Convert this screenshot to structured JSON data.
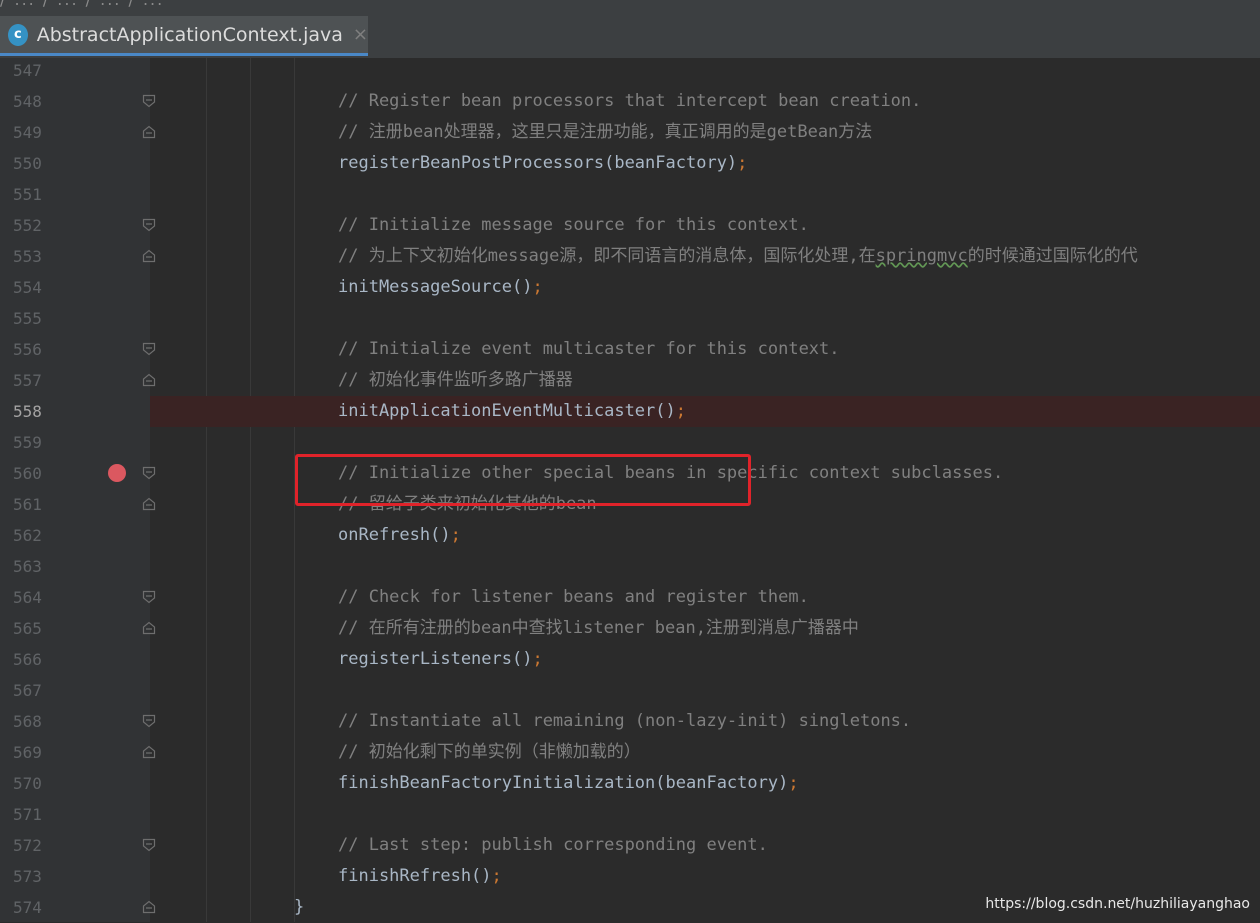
{
  "tab": {
    "icon_letter": "c",
    "file_name": "AbstractApplicationContext.java",
    "close": "×"
  },
  "breadcrumb_faded": "/ ... / ... / ... / ...",
  "current_line": 558,
  "lines": [
    {
      "num": "547",
      "parts": []
    },
    {
      "num": "548",
      "fold": "open",
      "parts": [
        {
          "t": "// Register bean processors that intercept bean creation.",
          "c": "comment"
        }
      ]
    },
    {
      "num": "549",
      "fold": "close",
      "parts": [
        {
          "t": "// 注册bean处理器，这里只是注册功能，真正调用的是getBean方法",
          "c": "comment"
        }
      ]
    },
    {
      "num": "550",
      "parts": [
        {
          "t": "registerBeanPostProcessors(beanFactory)",
          "c": "ident"
        },
        {
          "t": ";",
          "c": "semi"
        }
      ]
    },
    {
      "num": "551",
      "parts": []
    },
    {
      "num": "552",
      "fold": "open",
      "parts": [
        {
          "t": "// Initialize message source for this context.",
          "c": "comment"
        }
      ]
    },
    {
      "num": "553",
      "fold": "close",
      "parts": [
        {
          "t": "// 为上下文初始化message源，即不同语言的消息体，国际化处理,在",
          "c": "comment"
        },
        {
          "t": "springmvc",
          "c": "comment spell"
        },
        {
          "t": "的时候通过国际化的代",
          "c": "comment"
        }
      ]
    },
    {
      "num": "554",
      "parts": [
        {
          "t": "initMessageSource()",
          "c": "ident"
        },
        {
          "t": ";",
          "c": "semi"
        }
      ]
    },
    {
      "num": "555",
      "parts": []
    },
    {
      "num": "556",
      "fold": "open",
      "parts": [
        {
          "t": "// Initialize event multicaster for this context.",
          "c": "comment"
        }
      ]
    },
    {
      "num": "557",
      "fold": "close",
      "parts": [
        {
          "t": "// 初始化事件监听多路广播器",
          "c": "comment"
        }
      ]
    },
    {
      "num": "558",
      "bp": true,
      "parts": [
        {
          "t": "initApplicationEventMulticaster()",
          "c": "ident"
        },
        {
          "t": ";",
          "c": "semi"
        }
      ]
    },
    {
      "num": "559",
      "parts": []
    },
    {
      "num": "560",
      "fold": "open",
      "parts": [
        {
          "t": "// Initialize other special beans in specific context subclasses.",
          "c": "comment"
        }
      ]
    },
    {
      "num": "561",
      "fold": "close",
      "parts": [
        {
          "t": "// 留给子类来初始化其他的bean",
          "c": "comment"
        }
      ]
    },
    {
      "num": "562",
      "parts": [
        {
          "t": "onRefresh()",
          "c": "ident"
        },
        {
          "t": ";",
          "c": "semi"
        }
      ]
    },
    {
      "num": "563",
      "parts": []
    },
    {
      "num": "564",
      "fold": "open",
      "parts": [
        {
          "t": "// Check for listener beans and register them.",
          "c": "comment"
        }
      ]
    },
    {
      "num": "565",
      "fold": "close",
      "parts": [
        {
          "t": "// 在所有注册的bean中查找listener bean,注册到消息广播器中",
          "c": "comment"
        }
      ]
    },
    {
      "num": "566",
      "parts": [
        {
          "t": "registerListeners()",
          "c": "ident"
        },
        {
          "t": ";",
          "c": "semi"
        }
      ]
    },
    {
      "num": "567",
      "parts": []
    },
    {
      "num": "568",
      "fold": "open",
      "parts": [
        {
          "t": "// Instantiate all remaining (non-lazy-init) singletons.",
          "c": "comment"
        }
      ]
    },
    {
      "num": "569",
      "fold": "close",
      "parts": [
        {
          "t": "// 初始化剩下的单实例（非懒加载的）",
          "c": "comment"
        }
      ]
    },
    {
      "num": "570",
      "parts": [
        {
          "t": "finishBeanFactoryInitialization(beanFactory)",
          "c": "ident"
        },
        {
          "t": ";",
          "c": "semi"
        }
      ]
    },
    {
      "num": "571",
      "parts": []
    },
    {
      "num": "572",
      "fold": "open",
      "parts": [
        {
          "t": "// Last step: publish corresponding event.",
          "c": "comment"
        }
      ]
    },
    {
      "num": "573",
      "parts": [
        {
          "t": "finishRefresh()",
          "c": "ident"
        },
        {
          "t": ";",
          "c": "semi"
        }
      ]
    },
    {
      "num": "574",
      "fold": "close",
      "brace": true,
      "parts": [
        {
          "t": "}",
          "c": "brace"
        }
      ]
    }
  ],
  "watermark": "https://blog.csdn.net/huzhiliayanghao",
  "colors": {
    "comment": "#808080",
    "semicolon": "#cc7832",
    "identifier": "#a9b7c6",
    "breakpoint": "#db5860",
    "highlight_box": "#e0232a"
  }
}
